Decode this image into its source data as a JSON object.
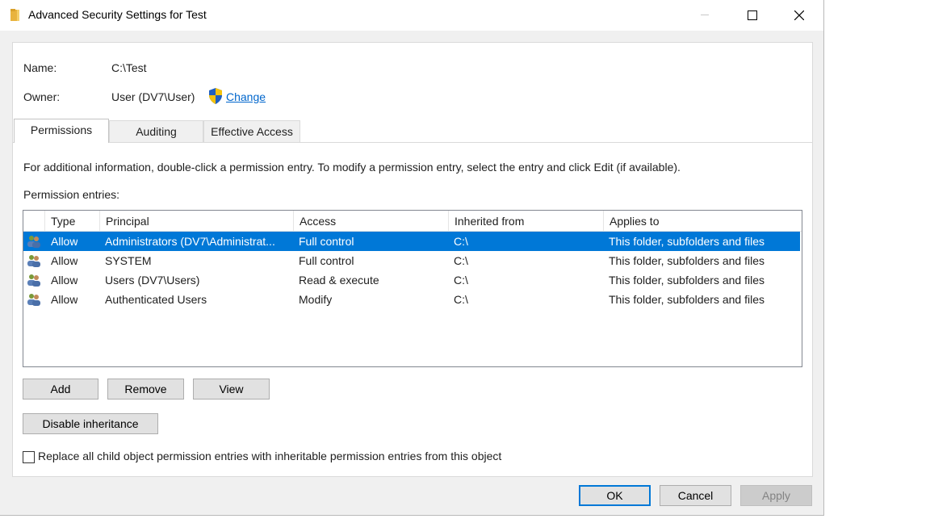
{
  "window": {
    "title": "Advanced Security Settings for Test",
    "icon": "folder-icon",
    "controls": [
      "minimize-icon",
      "maximize-icon",
      "close-icon"
    ]
  },
  "info": {
    "name_label": "Name:",
    "name_value": "C:\\Test",
    "owner_label": "Owner:",
    "owner_value": "User (DV7\\User)",
    "change_link": "Change",
    "change_icon": "uac-shield-icon"
  },
  "tabs": [
    {
      "label": "Permissions",
      "active": true
    },
    {
      "label": "Auditing",
      "active": false
    },
    {
      "label": "Effective Access",
      "active": false
    }
  ],
  "instructions": "For additional information, double-click a permission entry. To modify a permission entry, select the entry and click Edit (if available).",
  "entries_label": "Permission entries:",
  "table": {
    "columns": [
      "Type",
      "Principal",
      "Access",
      "Inherited from",
      "Applies to"
    ],
    "row_icon": "users-group-icon",
    "rows": [
      {
        "type": "Allow",
        "principal": "Administrators (DV7\\Administrat...",
        "access": "Full control",
        "inherited": "C:\\",
        "applies": "This folder, subfolders and files",
        "selected": true
      },
      {
        "type": "Allow",
        "principal": "SYSTEM",
        "access": "Full control",
        "inherited": "C:\\",
        "applies": "This folder, subfolders and files",
        "selected": false
      },
      {
        "type": "Allow",
        "principal": "Users (DV7\\Users)",
        "access": "Read & execute",
        "inherited": "C:\\",
        "applies": "This folder, subfolders and files",
        "selected": false
      },
      {
        "type": "Allow",
        "principal": "Authenticated Users",
        "access": "Modify",
        "inherited": "C:\\",
        "applies": "This folder, subfolders and files",
        "selected": false
      }
    ]
  },
  "buttons": {
    "add": "Add",
    "remove": "Remove",
    "view": "View",
    "disable_inheritance": "Disable inheritance",
    "ok": "OK",
    "cancel": "Cancel",
    "apply": "Apply"
  },
  "checkbox": {
    "label": "Replace all child object permission entries with inheritable permission entries from this object",
    "checked": false
  },
  "colors": {
    "selection": "#0078d7",
    "link": "#0066cc",
    "dialog_bg": "#f0f0f0"
  }
}
